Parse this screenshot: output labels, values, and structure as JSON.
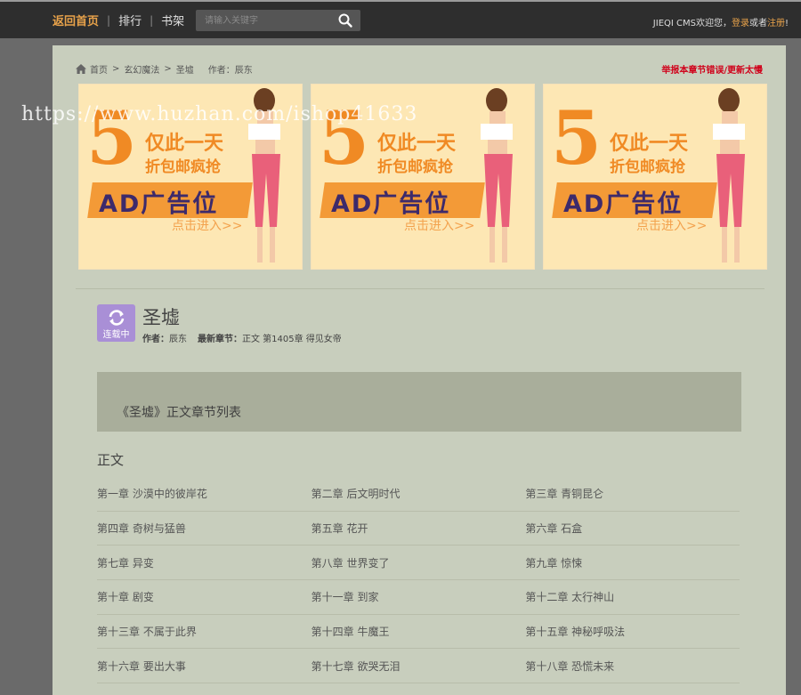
{
  "nav": {
    "home": "返回首页",
    "rank": "排行",
    "shelf": "书架"
  },
  "search": {
    "placeholder": "请输入关键字"
  },
  "user": {
    "welcome": "JIEQI CMS欢迎您，",
    "login": "登录",
    "or": "或者",
    "register": "注册",
    "end": "!"
  },
  "breadcrumb": {
    "home": "首页",
    "category": "玄幻魔法",
    "book": "圣墟",
    "author": "作者：辰东"
  },
  "report_link": "举报本章节错误/更新太慢",
  "ads": [
    {
      "num": "5",
      "line1": "仅此一天",
      "line2": "折包邮疯抢",
      "label": "AD广告位",
      "enter": "点击进入>>"
    },
    {
      "num": "5",
      "line1": "仅此一天",
      "line2": "折包邮疯抢",
      "label": "AD广告位",
      "enter": "点击进入>>"
    },
    {
      "num": "5",
      "line1": "仅此一天",
      "line2": "折包邮疯抢",
      "label": "AD广告位",
      "enter": "点击进入>>"
    }
  ],
  "book": {
    "status": "连载中",
    "title": "圣墟",
    "author_label": "作者：",
    "author": "辰东",
    "latest_label": "最新章节：",
    "latest": "正文 第1405章 得见女帝"
  },
  "list_title": "《圣墟》正文章节列表",
  "section_title": "正文",
  "chapters": [
    [
      "第一章 沙漠中的彼岸花",
      "第二章 后文明时代",
      "第三章 青铜昆仑"
    ],
    [
      "第四章 奇树与猛兽",
      "第五章 花开",
      "第六章 石盒"
    ],
    [
      "第七章 异变",
      "第八章 世界变了",
      "第九章 惊悚"
    ],
    [
      "第十章 剧变",
      "第十一章 到家",
      "第十二章 太行神山"
    ],
    [
      "第十三章 不属于此界",
      "第十四章 牛魔王",
      "第十五章 神秘呼吸法"
    ],
    [
      "第十六章 要出大事",
      "第十七章 欲哭无泪",
      "第十八章 恐慌未来"
    ]
  ],
  "watermark": "https://www.huzhan.com/ishop41633",
  "colors": {
    "topbar": "#2e2e2e",
    "accent": "#e8a24a",
    "panel": "#c8cebd",
    "report": "#d0021b",
    "status_badge": "#a98fd6"
  }
}
